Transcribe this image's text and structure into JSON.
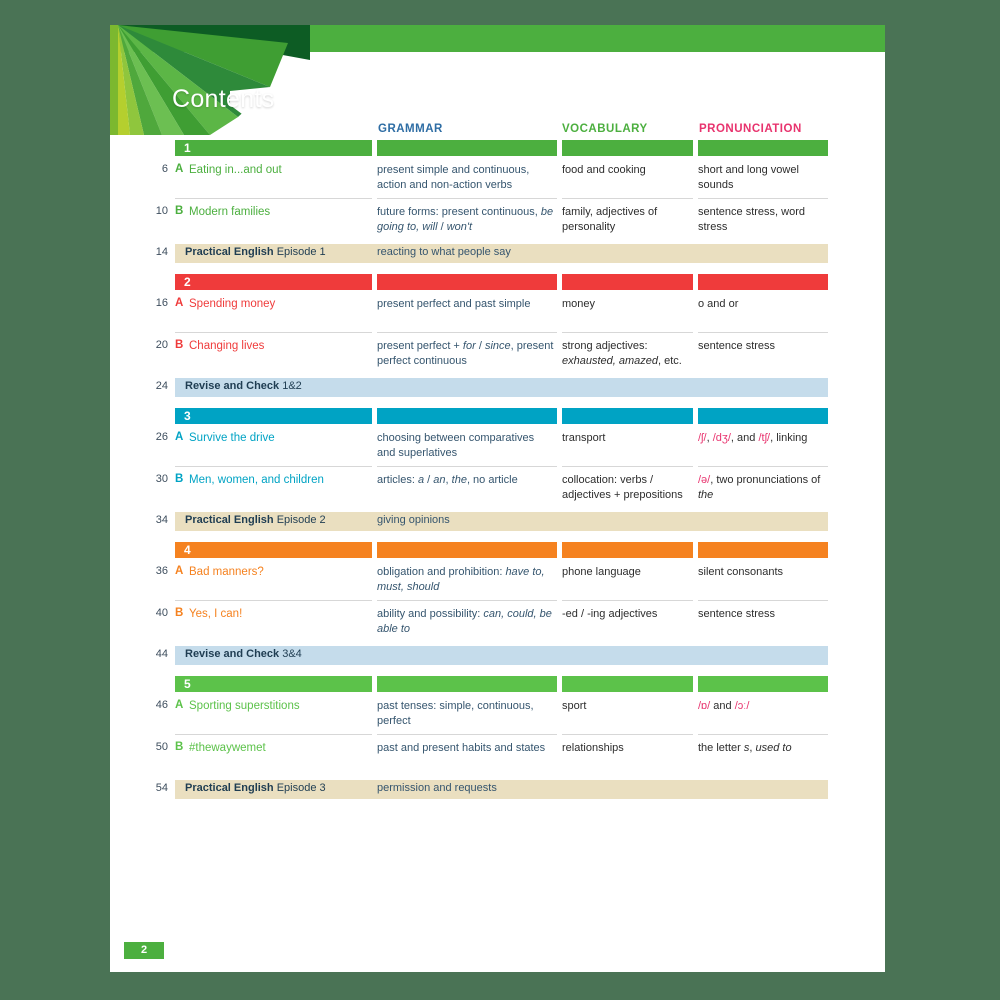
{
  "page": {
    "title": "Contents",
    "folio": "2",
    "background": "#4a7355",
    "topbar_color": "#4caf3f"
  },
  "columns": {
    "grammar": {
      "label": "GRAMMAR",
      "color": "#2e6da4"
    },
    "vocabulary": {
      "label": "VOCABULARY",
      "color": "#4caf3f"
    },
    "pronunciation": {
      "label": "PRONUNCIATION",
      "color": "#e8336e"
    }
  },
  "units": [
    {
      "number": "1",
      "color": "#4caf3f",
      "lessons": [
        {
          "page": "6",
          "letter": "A",
          "title": "Eating in...and out",
          "grammar": "present simple and continuous, action and non-action verbs",
          "vocabulary": "food and cooking",
          "pronunciation": "short and long vowel sounds"
        },
        {
          "page": "10",
          "letter": "B",
          "title": "Modern families",
          "grammar": "future forms: present continuous, <i>be going to, will</i> / <i>won't</i>",
          "vocabulary": "family, adjectives of personality",
          "pronunciation": "sentence stress, word stress"
        }
      ],
      "special": {
        "type": "practical",
        "page": "14",
        "label": "<b>Practical English</b> Episode 1",
        "desc": "reacting to what people say"
      }
    },
    {
      "number": "2",
      "color": "#ef3b3b",
      "lessons": [
        {
          "page": "16",
          "letter": "A",
          "title": "Spending money",
          "grammar": "present perfect and past simple",
          "vocabulary": "money",
          "pronunciation": "o and or"
        },
        {
          "page": "20",
          "letter": "B",
          "title": "Changing lives",
          "grammar": "present perfect + <i>for</i> / <i>since</i>, present perfect continuous",
          "vocabulary": "strong adjectives: <i>exhausted, amazed</i>, etc.",
          "pronunciation": "sentence stress"
        }
      ],
      "special": {
        "type": "revise",
        "page": "24",
        "label": "<b>Revise and Check</b> 1&2",
        "desc": ""
      }
    },
    {
      "number": "3",
      "color": "#00a3c4",
      "lessons": [
        {
          "page": "26",
          "letter": "A",
          "title": "Survive the drive",
          "grammar": "choosing between comparatives and superlatives",
          "vocabulary": "transport",
          "pronunciation": "<span class='ipa'>/ʃ/</span>, <span class='ipa'>/dʒ/</span>, and <span class='ipa'>/tʃ/</span>, linking"
        },
        {
          "page": "30",
          "letter": "B",
          "title": "Men, women, and children",
          "grammar": "articles: <i>a</i> / <i>an</i>, <i>the</i>, no article",
          "vocabulary": "collocation: verbs / adjectives + prepositions",
          "pronunciation": "<span class='ipa'>/ə/</span>, two pronunciations of <i>the</i>"
        }
      ],
      "special": {
        "type": "practical",
        "page": "34",
        "label": "<b>Practical English</b> Episode 2",
        "desc": "giving opinions"
      }
    },
    {
      "number": "4",
      "color": "#f58220",
      "lessons": [
        {
          "page": "36",
          "letter": "A",
          "title": "Bad manners?",
          "grammar": "obligation and prohibition: <i>have to, must, should</i>",
          "vocabulary": "phone language",
          "pronunciation": "silent consonants"
        },
        {
          "page": "40",
          "letter": "B",
          "title": "Yes, I can!",
          "grammar": "ability and possibility: <i>can, could, be able to</i>",
          "vocabulary": "-ed / -ing adjectives",
          "pronunciation": "sentence stress"
        }
      ],
      "special": {
        "type": "revise",
        "page": "44",
        "label": "<b>Revise and Check</b> 3&4",
        "desc": ""
      }
    },
    {
      "number": "5",
      "color": "#5cc24a",
      "lessons": [
        {
          "page": "46",
          "letter": "A",
          "title": "Sporting superstitions",
          "grammar": "past tenses: simple, continuous, perfect",
          "vocabulary": "sport",
          "pronunciation": "<span class='ipa'>/ɒ/</span> and <span class='ipa'>/ɔː/</span>"
        },
        {
          "page": "50",
          "letter": "B",
          "title": "#thewaywemet",
          "grammar": "past and present habits and states",
          "vocabulary": "relationships",
          "pronunciation": "the letter <i>s</i>, <i>used to</i>"
        }
      ],
      "special": {
        "type": "practical",
        "page": "54",
        "label": "<b>Practical English</b> Episode 3",
        "desc": "permission and requests"
      }
    }
  ]
}
